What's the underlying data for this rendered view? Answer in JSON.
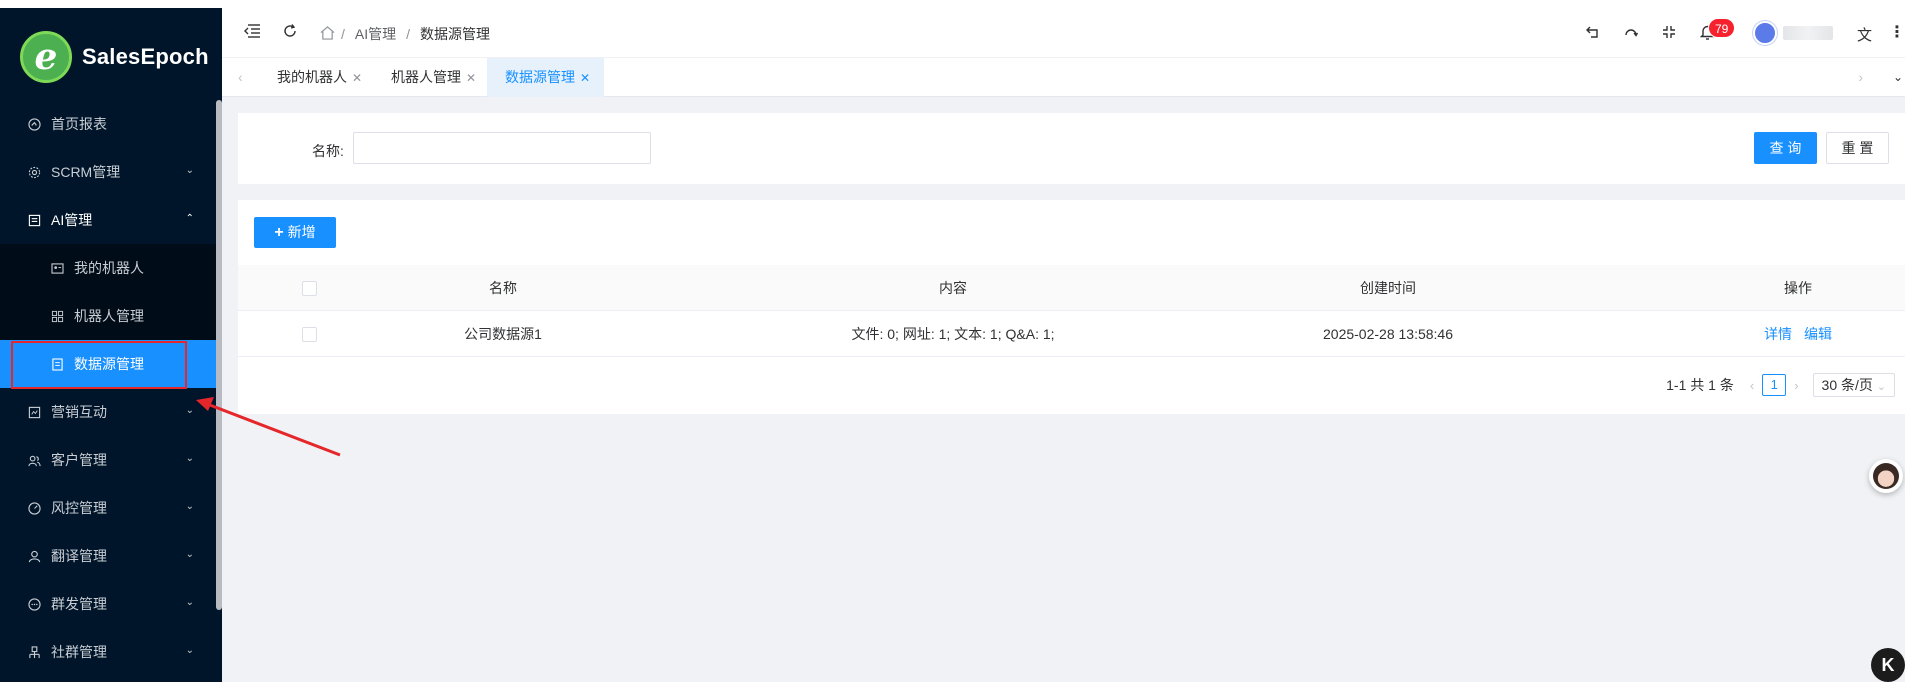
{
  "brand": {
    "logo_letter": "e",
    "name_part1": "Sales",
    "name_part2": "Epoch"
  },
  "sidebar": {
    "items": [
      {
        "label": "首页报表",
        "icon": "dashboard-icon",
        "has_arrow": false
      },
      {
        "label": "SCRM管理",
        "icon": "gear-icon",
        "has_arrow": true
      },
      {
        "label": "AI管理",
        "icon": "ai-icon",
        "has_arrow": true,
        "open": true
      },
      {
        "label": "营销互动",
        "icon": "marketing-icon",
        "has_arrow": true
      },
      {
        "label": "客户管理",
        "icon": "customers-icon",
        "has_arrow": true
      },
      {
        "label": "风控管理",
        "icon": "risk-icon",
        "has_arrow": true
      },
      {
        "label": "翻译管理",
        "icon": "user-icon",
        "has_arrow": true
      },
      {
        "label": "群发管理",
        "icon": "chat-icon",
        "has_arrow": true
      },
      {
        "label": "社群管理",
        "icon": "community-icon",
        "has_arrow": true
      }
    ],
    "ai_submenu": [
      {
        "label": "我的机器人",
        "icon": "robot-card-icon"
      },
      {
        "label": "机器人管理",
        "icon": "grid-icon"
      },
      {
        "label": "数据源管理",
        "icon": "document-icon",
        "active": true
      }
    ]
  },
  "header": {
    "breadcrumb": [
      "AI管理",
      "数据源管理"
    ],
    "breadcrumb_sep": "/",
    "notification_count": "79"
  },
  "tabs": [
    {
      "label": "我的机器人",
      "active": false
    },
    {
      "label": "机器人管理",
      "active": false
    },
    {
      "label": "数据源管理",
      "active": true
    }
  ],
  "search": {
    "name_label": "名称:",
    "name_value": "",
    "query_button": "查 询",
    "reset_button": "重 置"
  },
  "table": {
    "add_button": "新增",
    "columns": [
      "名称",
      "内容",
      "创建时间",
      "操作"
    ],
    "rows": [
      {
        "name": "公司数据源1",
        "content": "文件: 0; 网址: 1; 文本: 1; Q&A: 1;",
        "created": "2025-02-28 13:58:46",
        "actions": [
          "详情",
          "编辑"
        ]
      }
    ]
  },
  "pagination": {
    "summary": "1-1 共 1 条",
    "current_page": "1",
    "page_size": "30 条/页"
  },
  "colors": {
    "primary": "#1890ff",
    "sidebar_bg": "#001529",
    "annotation_red": "#e5262a",
    "badge_red": "#f5222d"
  }
}
